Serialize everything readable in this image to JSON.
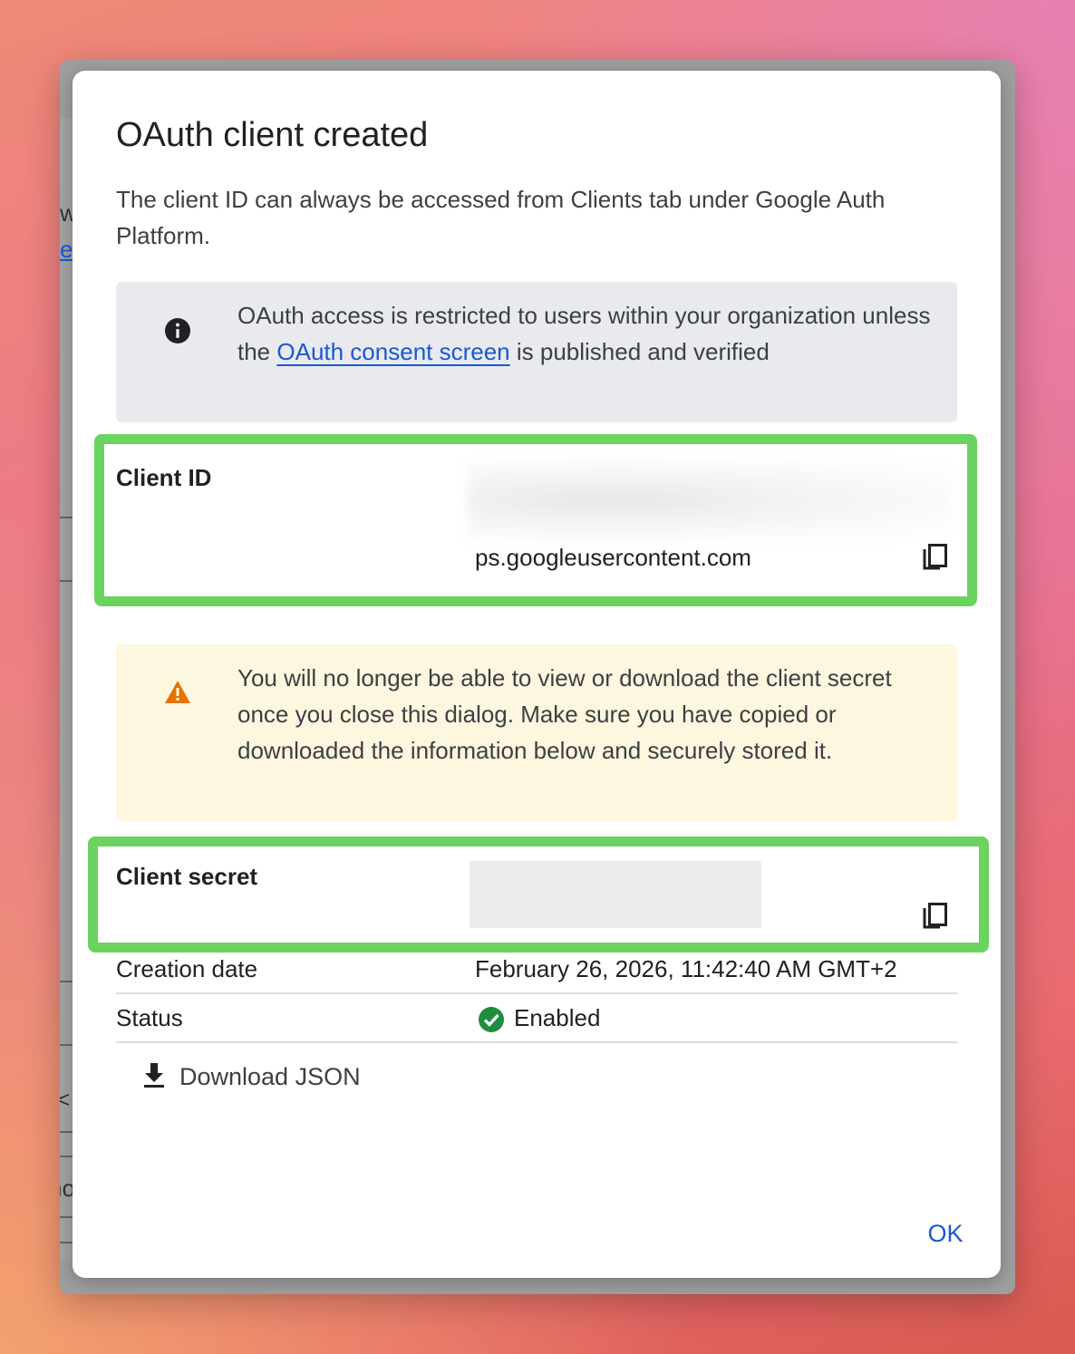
{
  "dialog": {
    "title": "OAuth client created",
    "subtitle": "The client ID can always be accessed from Clients tab under Google Auth Platform."
  },
  "info_notice": {
    "icon": "info-icon",
    "text_before": "OAuth access is restricted to users within your organization unless the ",
    "link_text": "OAuth consent screen",
    "text_after": " is published and verified"
  },
  "client_id": {
    "label": "Client ID",
    "value_visible": "ps.googleusercontent.com",
    "copy_icon": "copy-icon"
  },
  "warning_notice": {
    "icon": "warning-icon",
    "text": "You will no longer be able to view or download the client secret once you close this dialog. Make sure you have copied or downloaded the information below and securely stored it."
  },
  "client_secret": {
    "label": "Client secret",
    "copy_icon": "copy-icon"
  },
  "creation_date": {
    "label": "Creation date",
    "value": "February 26, 2026, 11:42:40 AM GMT+2"
  },
  "status": {
    "label": "Status",
    "value": "Enabled",
    "icon": "check-circle-icon",
    "color": "#1e8e3e"
  },
  "download_button": {
    "label": "Download JSON",
    "icon": "download-icon"
  },
  "ok_button": {
    "label": "OK"
  },
  "background_fragments": {
    "chars": [
      "w",
      "e",
      "<",
      "no"
    ]
  },
  "colors": {
    "highlight": "#6bd35f",
    "link": "#1a57d6",
    "warning": "#e37400",
    "info_bg": "#e8eaed",
    "warning_bg": "#fef7e0"
  }
}
